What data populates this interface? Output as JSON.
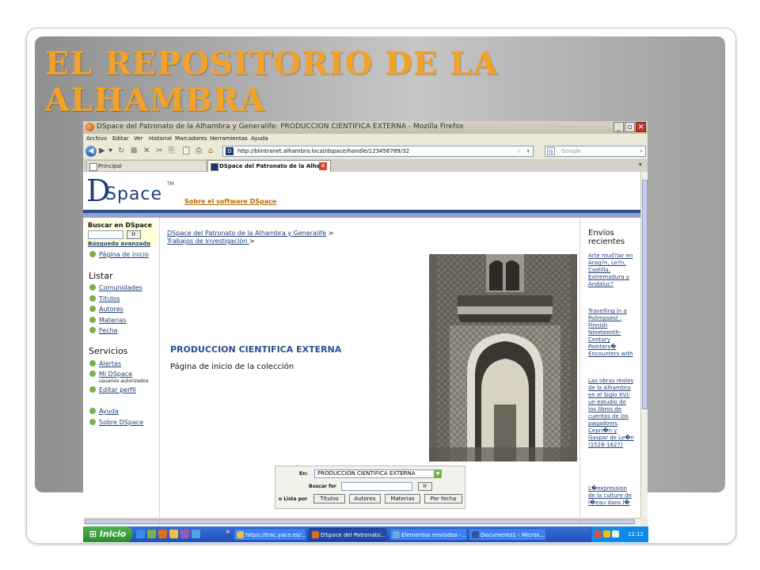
{
  "slide": {
    "title_line1": "EL REPOSITORIO DE LA",
    "title_line2": "ALHAMBRA",
    "accent_color": "#f3a229"
  },
  "browser": {
    "window_title": "DSpace del Patronato de la Alhambra y Generalife: PRODUCCION CIENTIFICA EXTERNA - Mozilla Firefox",
    "menu": [
      "Archivo",
      "Editar",
      "Ver",
      "Historial",
      "Marcadores",
      "Herramientas",
      "Ayuda"
    ],
    "url": "http://blintranet.alhambra.local/dspace/handle/123456789/32",
    "search_engine": "Google",
    "search_engine_icon": "G",
    "tabs": [
      {
        "label": "Principal",
        "active": false
      },
      {
        "label": "DSpace del Patronato de la Alha...",
        "active": true
      }
    ]
  },
  "dspace": {
    "logo_d": "D",
    "logo_space": "Space",
    "logo_tm": "TM",
    "about_link": "Sobre el software DSpace",
    "brand_color": "#2b4f8f",
    "sidebar": {
      "search_title": "Buscar en DSpace",
      "search_go": "Ir",
      "advanced_search": "Búsqueda avanzada",
      "home": "Página de inicio",
      "browse_heading": "Listar",
      "browse_items": [
        "Comunidades",
        "Títulos",
        "Autores",
        "Materias",
        "Fecha"
      ],
      "services_heading": "Servicios",
      "services_items": [
        "Alertas",
        "Mi DSpace",
        "Editar perfil"
      ],
      "mydspace_sub": "usuarios autorizados",
      "help_items": [
        "Ayuda",
        "Sobre DSpace"
      ]
    },
    "breadcrumb": {
      "community": "DSpace del Patronato de la Alhambra y Generalife",
      "subcommunity": "Trabajos de investigación ",
      "separator": ">"
    },
    "collection": {
      "title": "PRODUCCION CIENTIFICA EXTERNA",
      "home_label": "Página de inicio de la colección"
    },
    "collection_search": {
      "in_label": "En:",
      "scope_value": "PRODUCCION CIENTIFICA EXTERNA",
      "search_for_label": "Buscar for",
      "go": "Ir",
      "list_by_label": "o Lista por",
      "buttons": [
        "Títulos",
        "Autores",
        "Materias",
        "Por fecha"
      ]
    },
    "recent": {
      "title": "Envíos recientes",
      "items": [
        "Arte mud?jar en Arag?n, Le?n, Castilla, Extremadura y Andaluc?",
        "Travelling in a Palimpsest : Finnish Nineteenth-Century Painters� Encounters with",
        "Las obras reales de la Alhambra en el Siglo XVI: un estudio de los libros de cuentas de los pagadores Cepri�n y Gaspar de Le�n (1528-1627)",
        "L�expression de la culture de l�eau dans l�"
      ]
    }
  },
  "taskbar": {
    "start_label": "Inicio",
    "windows": [
      {
        "label": "https://trac.yaco.es/...",
        "active": false
      },
      {
        "label": "DSpace del Patronato...",
        "active": true
      },
      {
        "label": "Elementos enviados -...",
        "active": false
      },
      {
        "label": "Documento1 - Micros...",
        "active": false
      }
    ],
    "clock": "12:12"
  }
}
